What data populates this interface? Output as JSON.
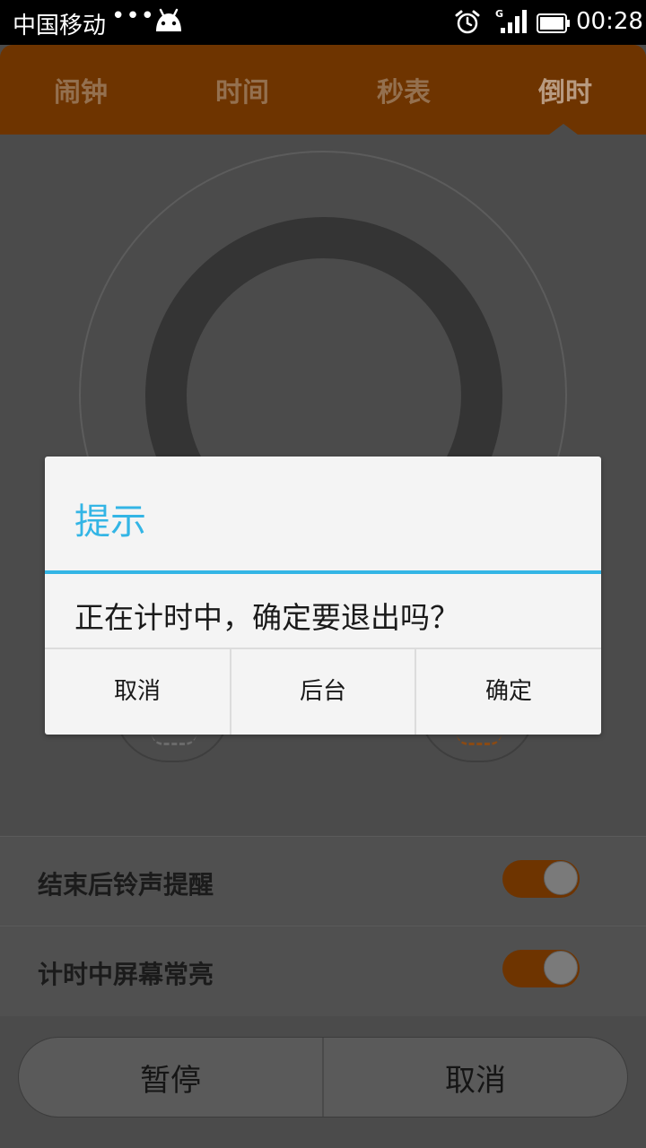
{
  "status_bar": {
    "carrier": "中国移动",
    "dots": "•••",
    "clock": "00:28",
    "signal_label": "G",
    "icons": [
      "android-icon",
      "alarm-clock-icon",
      "signal-icon",
      "battery-icon"
    ]
  },
  "tabs": [
    {
      "label": "闹钟",
      "active": false
    },
    {
      "label": "时间",
      "active": false
    },
    {
      "label": "秒表",
      "active": false
    },
    {
      "label": "倒时",
      "active": true
    }
  ],
  "settings": [
    {
      "label": "结束后铃声提醒",
      "on": true
    },
    {
      "label": "计时中屏幕常亮",
      "on": true
    }
  ],
  "bottom_buttons": {
    "pause": "暂停",
    "cancel": "取消"
  },
  "dialog": {
    "title": "提示",
    "message": "正在计时中，确定要退出吗？",
    "buttons": {
      "cancel": "取消",
      "background": "后台",
      "confirm": "确定"
    }
  },
  "colors": {
    "accent_blue": "#33b5e5",
    "tab_bar": "#6e3400",
    "toggle_on": "#6e3400"
  }
}
